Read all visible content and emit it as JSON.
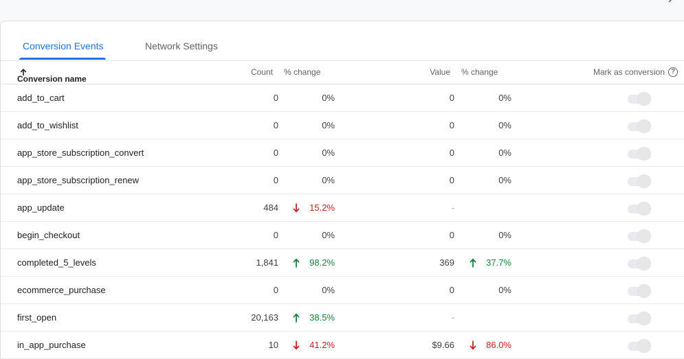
{
  "tabs": [
    {
      "label": "Conversion Events",
      "active": true
    },
    {
      "label": "Network Settings",
      "active": false
    }
  ],
  "table": {
    "headers": {
      "name": "Conversion name",
      "count": "Count",
      "count_change": "% change",
      "value": "Value",
      "value_change": "% change",
      "mark": "Mark as conversion"
    },
    "rows": [
      {
        "name": "add_to_cart",
        "count": "0",
        "count_change": "0%",
        "count_trend": "none",
        "value": "0",
        "value_change": "0%",
        "value_trend": "none"
      },
      {
        "name": "add_to_wishlist",
        "count": "0",
        "count_change": "0%",
        "count_trend": "none",
        "value": "0",
        "value_change": "0%",
        "value_trend": "none"
      },
      {
        "name": "app_store_subscription_convert",
        "count": "0",
        "count_change": "0%",
        "count_trend": "none",
        "value": "0",
        "value_change": "0%",
        "value_trend": "none"
      },
      {
        "name": "app_store_subscription_renew",
        "count": "0",
        "count_change": "0%",
        "count_trend": "none",
        "value": "0",
        "value_change": "0%",
        "value_trend": "none"
      },
      {
        "name": "app_update",
        "count": "484",
        "count_change": "15.2%",
        "count_trend": "down",
        "value": "-",
        "value_change": "",
        "value_trend": "none"
      },
      {
        "name": "begin_checkout",
        "count": "0",
        "count_change": "0%",
        "count_trend": "none",
        "value": "0",
        "value_change": "0%",
        "value_trend": "none"
      },
      {
        "name": "completed_5_levels",
        "count": "1,841",
        "count_change": "98.2%",
        "count_trend": "up",
        "value": "369",
        "value_change": "37.7%",
        "value_trend": "up"
      },
      {
        "name": "ecommerce_purchase",
        "count": "0",
        "count_change": "0%",
        "count_trend": "none",
        "value": "0",
        "value_change": "0%",
        "value_trend": "none"
      },
      {
        "name": "first_open",
        "count": "20,163",
        "count_change": "38.5%",
        "count_trend": "up",
        "value": "-",
        "value_change": "",
        "value_trend": "none"
      },
      {
        "name": "in_app_purchase",
        "count": "10",
        "count_change": "41.2%",
        "count_trend": "down",
        "value": "$9.66",
        "value_change": "86.0%",
        "value_trend": "down"
      }
    ]
  },
  "icons": {
    "sort": "arrow-up-icon",
    "help": "help-circle-icon",
    "trend_up": "arrow-up-icon",
    "trend_down": "arrow-down-icon",
    "corner": "chevron-icon"
  },
  "colors": {
    "accent": "#1a73e8",
    "up": "#188038",
    "down": "#c5221f",
    "text": "#202124",
    "muted": "#5f6368"
  }
}
